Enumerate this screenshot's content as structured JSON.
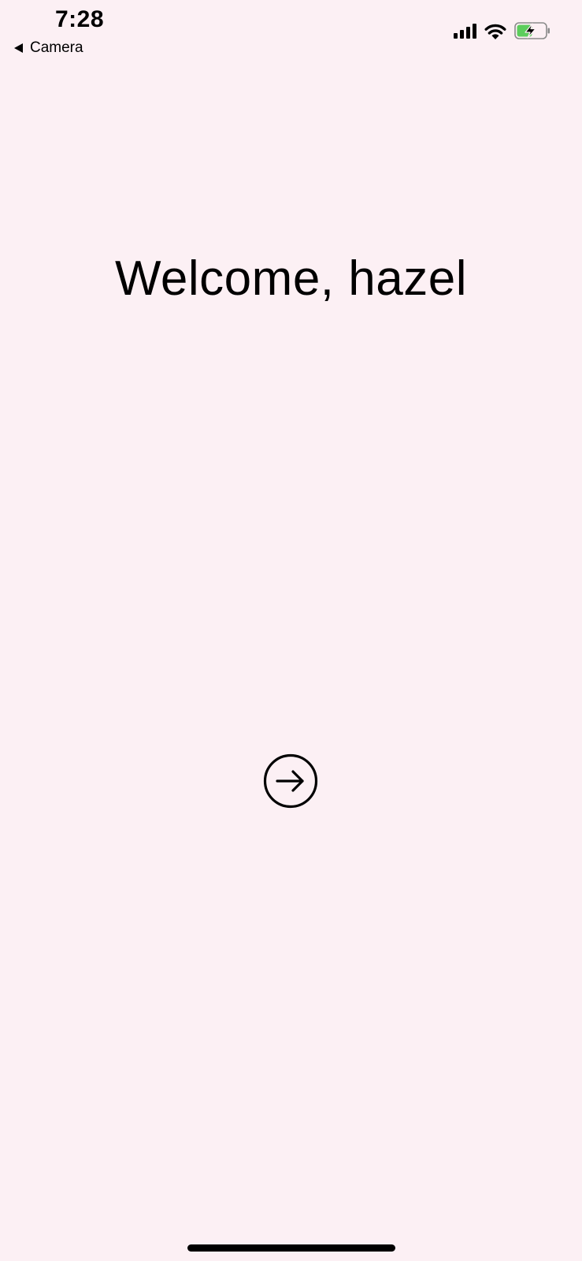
{
  "status_bar": {
    "time": "7:28",
    "back_label": "Camera",
    "icons": [
      "cellular-signal-icon",
      "wifi-icon",
      "battery-charging-icon"
    ],
    "battery_color": "#5ccd5c"
  },
  "main": {
    "welcome_text": "Welcome, hazel",
    "next_icon": "arrow-right-circle-icon"
  },
  "colors": {
    "background": "#fcf0f4",
    "foreground": "#000000"
  }
}
